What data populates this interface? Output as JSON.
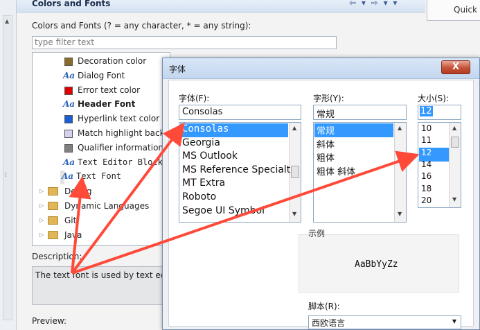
{
  "page": {
    "title": "Colors and Fonts",
    "quick_access": "Quick",
    "filter_label": "Colors and Fonts (? = any character, * = any string):",
    "filter_placeholder": "type filter text",
    "tree": [
      {
        "kind": "color",
        "color": "#8b6d2a",
        "label": "Decoration color"
      },
      {
        "kind": "font",
        "label": "Dialog Font"
      },
      {
        "kind": "color",
        "color": "#e00000",
        "label": "Error text color"
      },
      {
        "kind": "font",
        "label": "Header Font",
        "bold": true
      },
      {
        "kind": "color",
        "color": "#1a5fd6",
        "label": "Hyperlink text color"
      },
      {
        "kind": "color",
        "color": "#d8d0f0",
        "label": "Match highlight back"
      },
      {
        "kind": "color",
        "color": "#808080",
        "label": "Qualifier information"
      },
      {
        "kind": "font",
        "label": "Text Editor Block",
        "mono": true
      },
      {
        "kind": "font",
        "label": "Text Font",
        "mono": true,
        "selected": true
      }
    ],
    "categories": [
      "Debug",
      "Dynamic Languages",
      "Git",
      "Java"
    ],
    "description_label": "Description:",
    "description_text": "The text font is used by text ed",
    "preview_label": "Preview:"
  },
  "dialog": {
    "title": "字体",
    "close_label": "X",
    "font_label": "字体(F):",
    "font_value": "Consolas",
    "fonts": [
      "Consolas",
      "Georgia",
      "MS Outlook",
      "MS Reference Specialt",
      "MT Extra",
      "Roboto",
      "Segoe UI Symbol"
    ],
    "style_label": "字形(Y):",
    "style_value": "常规",
    "styles": [
      "常规",
      "斜体",
      "粗体",
      "粗体 斜体"
    ],
    "size_label": "大小(S):",
    "size_value": "12",
    "sizes": [
      "10",
      "11",
      "12",
      "14",
      "16",
      "18",
      "20"
    ],
    "sample_label": "示例",
    "sample_text": "AaBbYyZz",
    "script_label": "脚本(R):",
    "script_value": "西欧语言"
  },
  "colors": {
    "selection": "#3399ff",
    "arrow": "#ff4a3a"
  }
}
